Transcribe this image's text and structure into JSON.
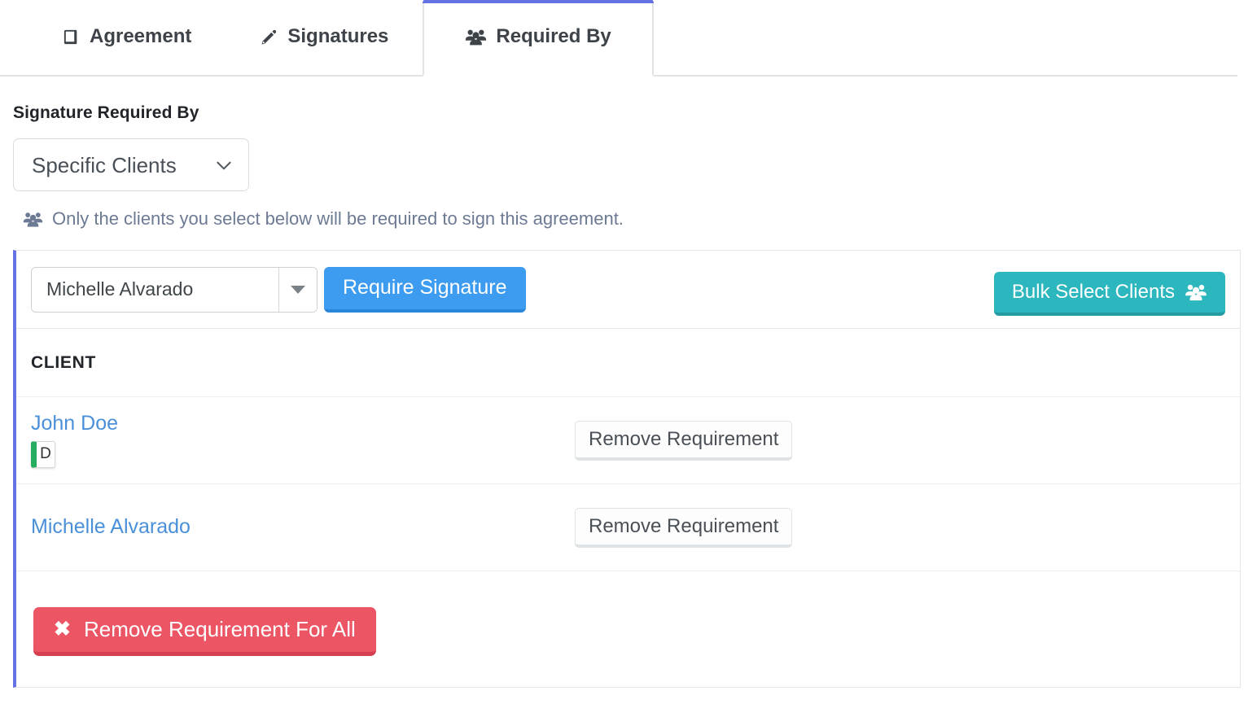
{
  "tabs": [
    {
      "label": "Agreement",
      "icon": "book-icon",
      "active": false
    },
    {
      "label": "Signatures",
      "icon": "pencil-icon",
      "active": false
    },
    {
      "label": "Required By",
      "icon": "users-icon",
      "active": true
    }
  ],
  "form": {
    "field_label": "Signature Required By",
    "select_value": "Specific Clients",
    "select_icon": "chevron-down-icon",
    "helper_icon": "users-icon",
    "helper_text": "Only the clients you select below will be required to sign this agreement."
  },
  "toolbar": {
    "client_select_value": "Michelle Alvarado",
    "require_signature_label": "Require Signature",
    "bulk_select_label": "Bulk Select Clients",
    "bulk_select_icon": "users-icon"
  },
  "table": {
    "header_client": "CLIENT",
    "rows": [
      {
        "name": "John Doe",
        "badge": "D",
        "action_label": "Remove Requirement"
      },
      {
        "name": "Michelle Alvarado",
        "badge": null,
        "action_label": "Remove Requirement"
      }
    ]
  },
  "footer": {
    "remove_all_label": "Remove Requirement For All",
    "remove_all_icon": "times-icon",
    "remove_all_glyph": "✖"
  },
  "colors": {
    "accent_purple": "#6572e4",
    "primary_blue": "#3d9bf0",
    "teal": "#2cb6bd",
    "danger_red": "#ec5564",
    "link_blue": "#4a90d9",
    "badge_green": "#27ad5f",
    "muted_text": "#6c7a93"
  }
}
